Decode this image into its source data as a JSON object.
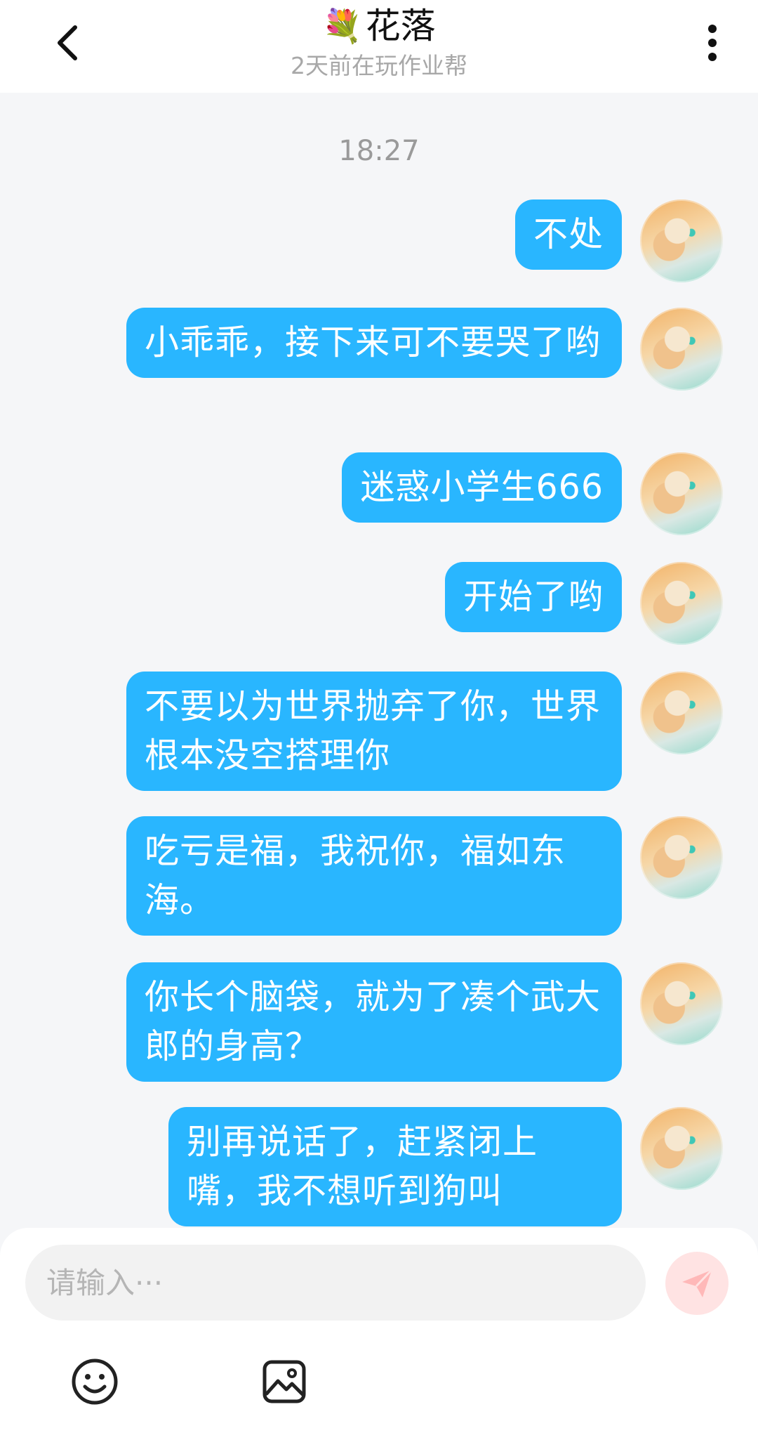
{
  "header": {
    "title_emoji": "💐",
    "title": "花落",
    "subtitle": "2天前在玩作业帮"
  },
  "chat": {
    "timestamp": "18:27",
    "bubble_color": "#29b6ff",
    "messages": [
      {
        "text": "不处"
      },
      {
        "text": "小乖乖，接下来可不要哭了哟"
      },
      {
        "text": "迷惑小学生666"
      },
      {
        "text": "开始了哟"
      },
      {
        "text": "不要以为世界抛弃了你，世界根本没空搭理你"
      },
      {
        "text": "吃亏是福，我祝你，福如东海。"
      },
      {
        "text": "你长个脑袋，就为了凑个武大郎的身高？"
      },
      {
        "text": "别再说话了，赶紧闭上嘴，我不想听到狗叫"
      }
    ]
  },
  "input": {
    "placeholder": "请输入···"
  },
  "icons": {
    "back": "chevron-left-icon",
    "more": "more-vertical-icon",
    "send": "send-icon",
    "emoji": "emoji-icon",
    "image": "image-icon"
  }
}
